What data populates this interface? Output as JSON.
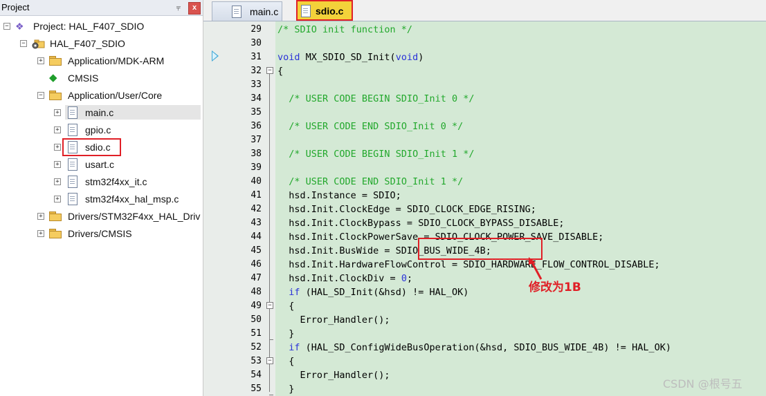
{
  "project_panel": {
    "title": "Project",
    "pin_glyph": "⫧",
    "close_glyph": "x",
    "tree": [
      {
        "label": "Project: HAL_F407_SDIO",
        "icon": "project-icon",
        "level": 0
      },
      {
        "label": "HAL_F407_SDIO",
        "icon": "target-icon",
        "level": 1
      },
      {
        "label": "Application/MDK-ARM",
        "icon": "folder-icon",
        "level": 2
      },
      {
        "label": "CMSIS",
        "icon": "cmsis-gem-icon",
        "level": 2
      },
      {
        "label": "Application/User/Core",
        "icon": "folder-icon",
        "level": 2
      },
      {
        "label": "main.c",
        "icon": "file-icon",
        "level": 3,
        "selected": true
      },
      {
        "label": "gpio.c",
        "icon": "file-icon",
        "level": 3
      },
      {
        "label": "sdio.c",
        "icon": "file-icon",
        "level": 3,
        "highlighted": true
      },
      {
        "label": "usart.c",
        "icon": "file-icon",
        "level": 3
      },
      {
        "label": "stm32f4xx_it.c",
        "icon": "file-icon",
        "level": 3
      },
      {
        "label": "stm32f4xx_hal_msp.c",
        "icon": "file-icon",
        "level": 3
      },
      {
        "label": "Drivers/STM32F4xx_HAL_Driv",
        "icon": "folder-icon",
        "level": 2
      },
      {
        "label": "Drivers/CMSIS",
        "icon": "folder-icon",
        "level": 2
      }
    ]
  },
  "editor": {
    "tabs": [
      {
        "label": "main.c",
        "active": false
      },
      {
        "label": "sdio.c",
        "active": true
      }
    ],
    "lines": [
      {
        "n": "29",
        "text": "/* SDIO init function */"
      },
      {
        "n": "30",
        "text": ""
      },
      {
        "n": "31",
        "text": "void MX_SDIO_SD_Init(void)"
      },
      {
        "n": "32",
        "text": "{"
      },
      {
        "n": "33",
        "text": ""
      },
      {
        "n": "34",
        "text": "  /* USER CODE BEGIN SDIO_Init 0 */"
      },
      {
        "n": "35",
        "text": ""
      },
      {
        "n": "36",
        "text": "  /* USER CODE END SDIO_Init 0 */"
      },
      {
        "n": "37",
        "text": ""
      },
      {
        "n": "38",
        "text": "  /* USER CODE BEGIN SDIO_Init 1 */"
      },
      {
        "n": "39",
        "text": ""
      },
      {
        "n": "40",
        "text": "  /* USER CODE END SDIO_Init 1 */"
      },
      {
        "n": "41",
        "text": "  hsd.Instance = SDIO;"
      },
      {
        "n": "42",
        "text": "  hsd.Init.ClockEdge = SDIO_CLOCK_EDGE_RISING;"
      },
      {
        "n": "43",
        "text": "  hsd.Init.ClockBypass = SDIO_CLOCK_BYPASS_DISABLE;"
      },
      {
        "n": "44",
        "text": "  hsd.Init.ClockPowerSave = SDIO_CLOCK_POWER_SAVE_DISABLE;"
      },
      {
        "n": "45",
        "text": "  hsd.Init.BusWide = SDIO_BUS_WIDE_4B;"
      },
      {
        "n": "46",
        "text": "  hsd.Init.HardwareFlowControl = SDIO_HARDWARE_FLOW_CONTROL_DISABLE;"
      },
      {
        "n": "47",
        "text": "  hsd.Init.ClockDiv = 0;"
      },
      {
        "n": "48",
        "text": "  if (HAL_SD_Init(&hsd) != HAL_OK)"
      },
      {
        "n": "49",
        "text": "  {"
      },
      {
        "n": "50",
        "text": "    Error_Handler();"
      },
      {
        "n": "51",
        "text": "  }"
      },
      {
        "n": "52",
        "text": "  if (HAL_SD_ConfigWideBusOperation(&hsd, SDIO_BUS_WIDE_4B) != HAL_OK)"
      },
      {
        "n": "53",
        "text": "  {"
      },
      {
        "n": "54",
        "text": "    Error_Handler();"
      },
      {
        "n": "55",
        "text": "  }"
      }
    ]
  },
  "annotation": {
    "text": "修改为1B",
    "color": "#e01f26"
  },
  "watermark": "CSDN @根号五",
  "colors": {
    "code_background": "#d4e9d5",
    "comment": "#22a82c",
    "keyword": "#2a32d8",
    "active_tab": "#f3d23a",
    "highlight_box": "#e01f26"
  }
}
